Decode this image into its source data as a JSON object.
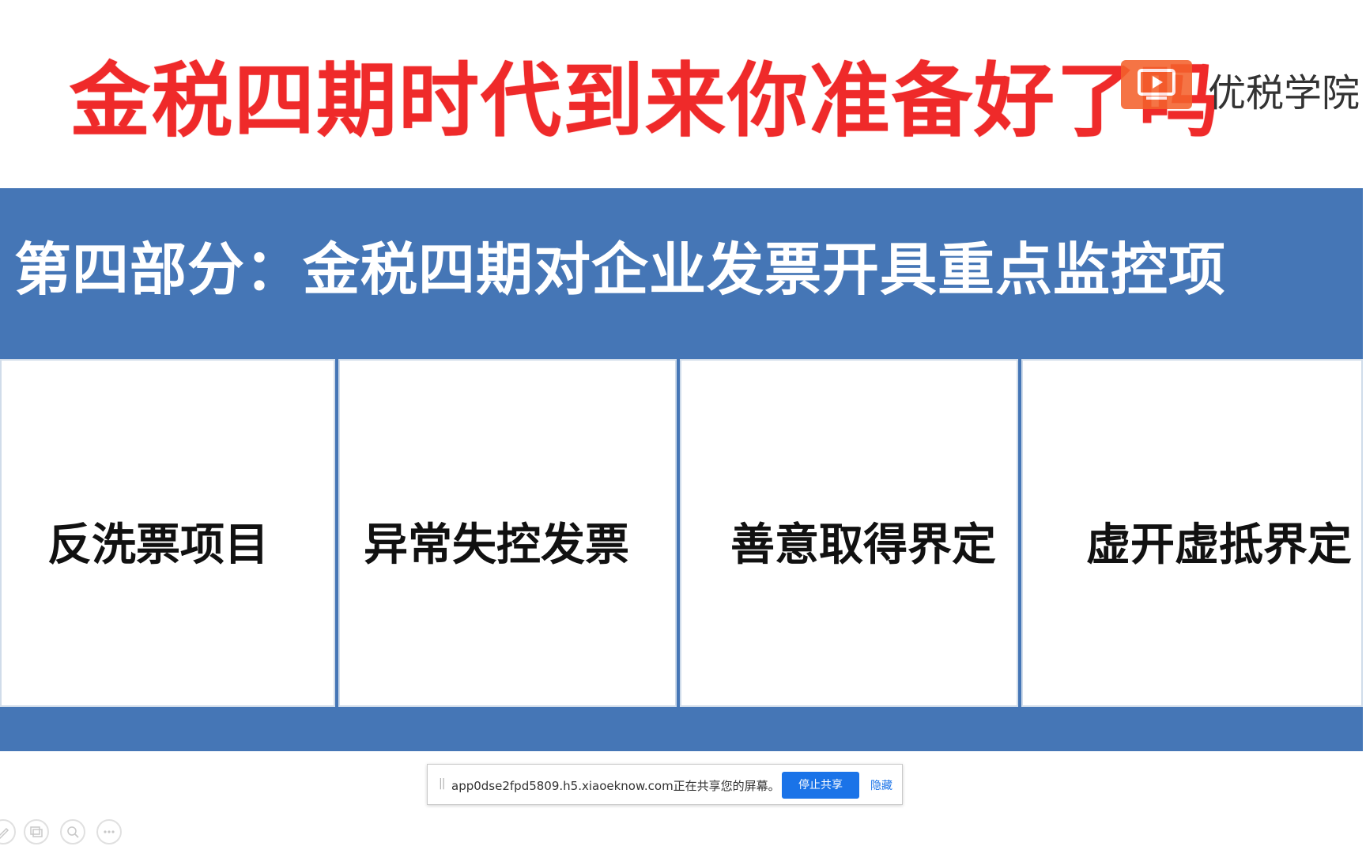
{
  "title": "金税四期时代到来你准备好了吗",
  "brand": {
    "name": "优税学院",
    "logo_icon": "play-video-icon",
    "logo_color": "#f4612c"
  },
  "section": {
    "title": "第四部分：金税四期对企业发票开具重点监控项",
    "background_color": "#4576b6"
  },
  "cards": [
    {
      "label": "反洗票项目"
    },
    {
      "label": "异常失控发票"
    },
    {
      "label": "善意取得界定"
    },
    {
      "label": "虚开虚抵界定"
    }
  ],
  "share_bar": {
    "message": "app0dse2fpd5809.h5.xiaoeknow.com正在共享您的屏幕。",
    "stop_label": "停止共享",
    "hide_label": "隐藏",
    "stop_color": "#1a73e8"
  },
  "toolbar": {
    "icons": [
      "pen-icon",
      "gallery-icon",
      "zoom-icon",
      "more-icon"
    ]
  },
  "title_color": "#ef2a2a"
}
